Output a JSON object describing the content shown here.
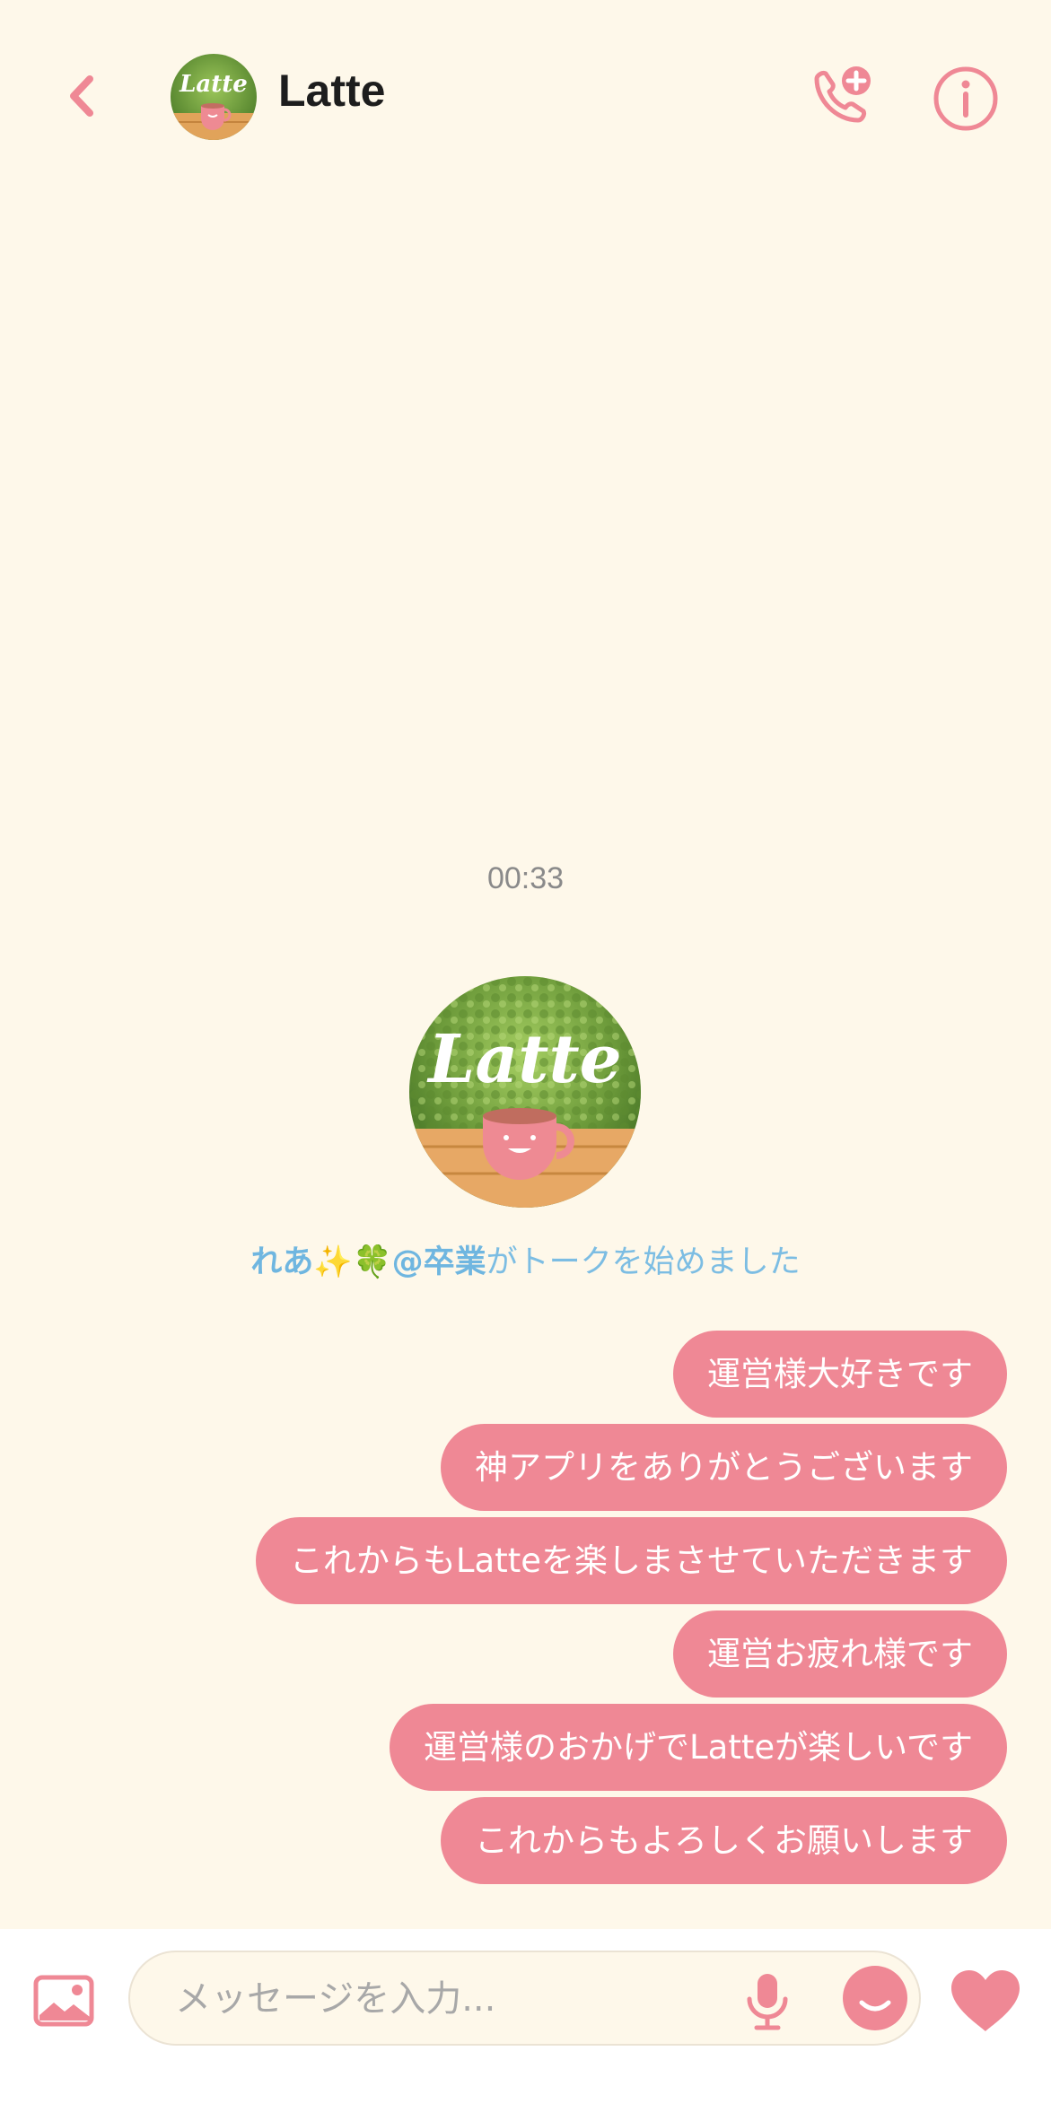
{
  "header": {
    "title": "Latte",
    "avatar_text": "Latte"
  },
  "chat": {
    "timestamp": "00:33",
    "avatar_text": "Latte",
    "system_name": "れあ✨🍀@卒業",
    "system_text": "がトークを始めました",
    "messages": [
      "運営様大好きです",
      "神アプリをありがとうございます",
      "これからもLatteを楽しまさせていただきます",
      "運営お疲れ様です",
      "運営様のおかげでLatteが楽しいです",
      "これからもよろしくお願いします"
    ]
  },
  "composer": {
    "placeholder": "メッセージを入力..."
  },
  "colors": {
    "accent": "#ef8895",
    "background": "#fef8ea",
    "system_text": "#7cbde3"
  },
  "icons": [
    "back-icon",
    "add-call-icon",
    "info-icon",
    "image-icon",
    "mic-icon",
    "emoji-icon",
    "heart-icon"
  ]
}
